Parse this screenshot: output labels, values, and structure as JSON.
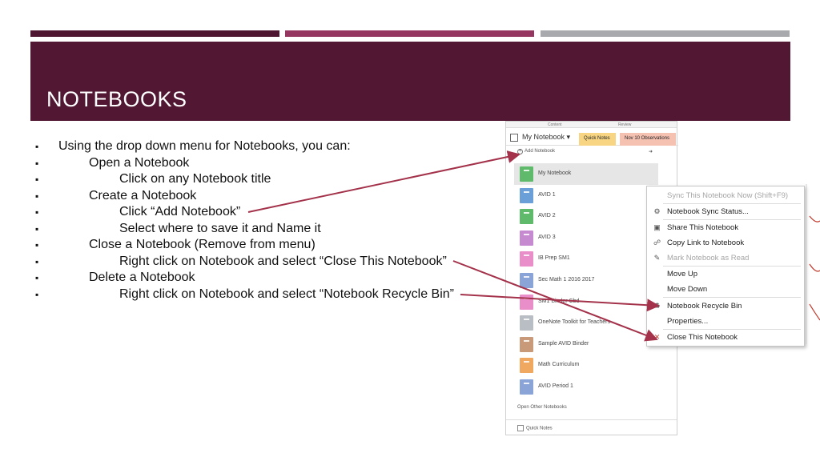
{
  "slide": {
    "title": "NOTEBOOKS"
  },
  "bullets": [
    {
      "level": 1,
      "text": "Using the drop down menu for Notebooks, you can:"
    },
    {
      "level": 2,
      "text": "Open a Notebook"
    },
    {
      "level": 3,
      "text": "Click on any Notebook title"
    },
    {
      "level": 2,
      "text": "Create a Notebook"
    },
    {
      "level": 3,
      "text": "Click “Add Notebook”"
    },
    {
      "level": 3,
      "text": "Select where to save it and Name it"
    },
    {
      "level": 2,
      "text": "Close a Notebook (Remove from menu)"
    },
    {
      "level": 3,
      "text": "Right click on Notebook and select “Close This Notebook”"
    },
    {
      "level": 2,
      "text": "Delete a Notebook"
    },
    {
      "level": 3,
      "text": "Right click on Notebook and select “Notebook Recycle Bin”"
    }
  ],
  "onenote": {
    "ribbon_labels": {
      "content": "Content",
      "review": "Review"
    },
    "current_notebook": "My Notebook",
    "tabs": {
      "quick_notes": "Quick Notes",
      "nov10": "Nov 10 Observations"
    },
    "add_notebook": "Add Notebook",
    "pin_icon": "pin-icon",
    "notebooks": [
      {
        "name": "My Notebook",
        "color": "#5fba6b",
        "selected": true
      },
      {
        "name": "AVID 1",
        "color": "#6a9fd8"
      },
      {
        "name": "AVID 2",
        "color": "#5fba6b"
      },
      {
        "name": "AVID 3",
        "color": "#c58ad0"
      },
      {
        "name": "IB Prep SM1",
        "color": "#e98ec8"
      },
      {
        "name": "Sec Math 1 2016 2017",
        "color": "#8aa4d8"
      },
      {
        "name": "SM1 Binder Cbd",
        "color": "#e98ec8"
      },
      {
        "name": "OneNote Toolkit for Teachers",
        "color": "#b9bec4"
      },
      {
        "name": "Sample AVID Binder",
        "color": "#c99a7a"
      },
      {
        "name": "Math Curriculum",
        "color": "#f0a860"
      },
      {
        "name": "AVID Period 1",
        "color": "#8aa4d8"
      }
    ],
    "open_other": "Open Other Notebooks",
    "quick_notes_footer": "Quick Notes"
  },
  "context_menu": {
    "items": [
      {
        "label": "Sync This Notebook Now  (Shift+F9)",
        "disabled": true,
        "icon": ""
      },
      {
        "label": "Notebook Sync Status...",
        "disabled": false,
        "icon": "sync-status-icon"
      },
      {
        "label": "Share This Notebook",
        "disabled": false,
        "icon": "share-icon"
      },
      {
        "label": "Copy Link to Notebook",
        "disabled": false,
        "icon": "link-icon"
      },
      {
        "label": "Mark Notebook as Read",
        "disabled": true,
        "icon": "mark-read-icon"
      },
      {
        "label": "Move Up",
        "disabled": false,
        "icon": ""
      },
      {
        "label": "Move Down",
        "disabled": false,
        "icon": ""
      },
      {
        "label": "Notebook Recycle Bin",
        "disabled": false,
        "icon": "recycle-bin-icon"
      },
      {
        "label": "Properties...",
        "disabled": false,
        "icon": ""
      },
      {
        "label": "Close This Notebook",
        "disabled": false,
        "icon": "close-notebook-icon"
      }
    ]
  },
  "colors": {
    "title_band": "#511733",
    "arrow": "#a3324a",
    "disabled_text": "#a6a6a6"
  }
}
